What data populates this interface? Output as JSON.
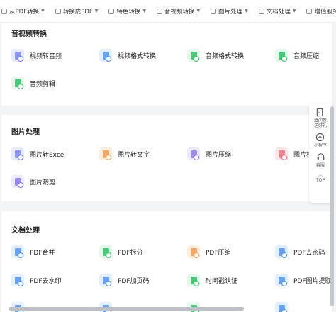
{
  "nav": [
    {
      "label": "从PDF转换",
      "icon": "pdf-icon"
    },
    {
      "label": "转换成PDF",
      "icon": "convert-icon"
    },
    {
      "label": "特色转换",
      "icon": "special-icon"
    },
    {
      "label": "音视频转换",
      "icon": "media-icon"
    },
    {
      "label": "图片处理",
      "icon": "image-icon"
    },
    {
      "label": "文档处理",
      "icon": "document-icon"
    },
    {
      "label": "增值服务",
      "icon": "service-icon"
    }
  ],
  "sections": {
    "media": {
      "title": "音视频转换",
      "tools": [
        "视频转音频",
        "视频格式转换",
        "音频格式转换",
        "音频压缩",
        "音频剪辑"
      ]
    },
    "image": {
      "title": "图片处理",
      "tools": [
        "图片转Excel",
        "图片转文字",
        "图片压缩",
        "图片格",
        "图片裁剪"
      ]
    },
    "docs": {
      "title": "文档处理",
      "tools": [
        "PDF合并",
        "PDF拆分",
        "PDF压缩",
        "PDF去密码",
        "PDF去水印",
        "PDF加页码",
        "时间戳认证",
        "PDF图片提取"
      ]
    }
  },
  "float": {
    "survey": "填问卷\n送好礼",
    "miniprogram": "小程序",
    "service": "客服",
    "top": "TOP"
  },
  "colors": {
    "blue": "#6b7cf6",
    "green": "#3cc46b",
    "orange": "#f09a4e",
    "red": "#ee6b7a"
  }
}
